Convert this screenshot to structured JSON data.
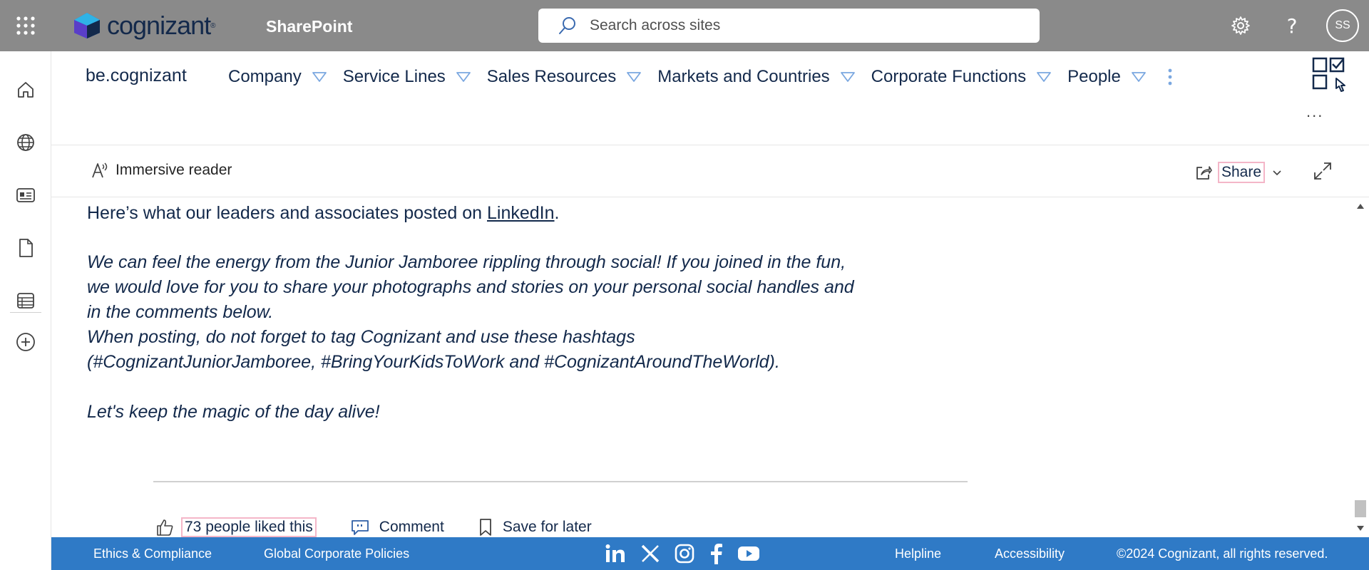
{
  "suite_bar": {
    "logo_text": "cognizant",
    "app_name": "SharePoint",
    "search_placeholder": "Search across sites",
    "avatar_initials": "SS"
  },
  "hub_nav": {
    "site_title": "be.cognizant",
    "items": [
      {
        "label": "Company"
      },
      {
        "label": "Service Lines"
      },
      {
        "label": "Sales Resources"
      },
      {
        "label": "Markets and Countries"
      },
      {
        "label": "Corporate Functions"
      },
      {
        "label": "People"
      }
    ],
    "ellipsis": "..."
  },
  "command_bar": {
    "immersive_reader": "Immersive reader",
    "share": "Share"
  },
  "content": {
    "intro_prefix": "Here’s what our leaders and associates posted on ",
    "intro_link": "LinkedIn",
    "intro_suffix": ".",
    "lines": [
      "We can feel the energy from the Junior Jamboree rippling through social! If you joined in the fun,",
      "we would love for you to share your photographs and stories on your personal social handles and",
      "in the comments below.",
      "When posting, do not forget to tag Cognizant and use these hashtags",
      "(#CognizantJuniorJamboree, #BringYourKidsToWork and #CognizantAroundTheWorld).",
      "Let's keep the magic of the day alive!"
    ]
  },
  "actions": {
    "likes": "73 people liked this",
    "comment": "Comment",
    "save": "Save for later"
  },
  "footer": {
    "ethics": "Ethics & Compliance",
    "policies": "Global Corporate Policies",
    "helpline": "Helpline",
    "accessibility": "Accessibility",
    "copyright": "©2024 Cognizant, all rights reserved."
  },
  "colors": {
    "suite_bar": "#8a8a8a",
    "brand_navy": "#13294b",
    "footer": "#2f7ac6",
    "nav_triangle": "#7aa7e0",
    "highlight_border": "#f4b6c8"
  }
}
